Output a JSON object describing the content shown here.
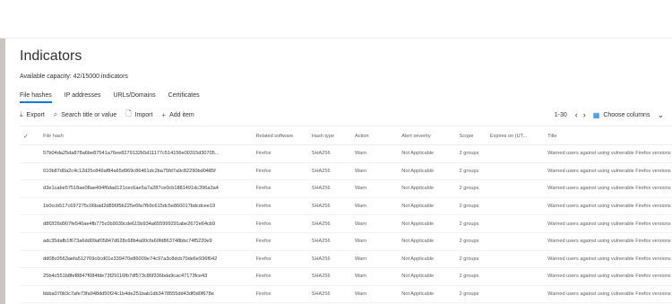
{
  "page": {
    "title": "Indicators",
    "capacity": "Available capacity: 42/15000 indicators"
  },
  "tabs": [
    {
      "label": "File hashes",
      "selected": true
    },
    {
      "label": "IP addresses",
      "selected": false
    },
    {
      "label": "URLs/Domains",
      "selected": false
    },
    {
      "label": "Certificates",
      "selected": false
    }
  ],
  "toolbar": {
    "export_label": "Export",
    "search_label": "Search title or value",
    "import_label": "Import",
    "add_label": "Add item",
    "pager": "1-30",
    "columns_label": "Choose columns"
  },
  "table": {
    "headers": [
      "File hash",
      "Related software",
      "Hash type",
      "Action",
      "Alert severity",
      "Scope",
      "Expires on (UT...",
      "Title"
    ],
    "rows": [
      [
        "57b04da25da878a6be87541a76ee8279132b5d11177c514156e00315d30705...",
        "Firefox",
        "SHA256",
        "Warn",
        "Not Applicable",
        "2 groups",
        "",
        "Warned users against using vulnerable Firefox versions"
      ],
      [
        "010b87d0a2c4c12d25c849af84a65d969c86461dc2ba75fd7a9c82290bd0485f",
        "Firefox",
        "SHA256",
        "Warn",
        "Not Applicable",
        "2 groups",
        "",
        "Warned users against using vulnerable Firefox versions"
      ],
      [
        "d3e1cabe57518ae08ae494f6dad121cec6ae5a7a287ce0cb1881491dc396a3a4",
        "Firefox",
        "SHA256",
        "Warn",
        "Not Applicable",
        "2 groups",
        "",
        "Warned users against using vulnerable Firefox versions"
      ],
      [
        "1b0ccb517c697275c06bad2d896f5b225e6fa7fb9c615dc5e860017bdcdcee19",
        "Firefox",
        "SHA256",
        "Warn",
        "Not Applicable",
        "2 groups",
        "",
        "Warned users against using vulnerable Firefox versions"
      ],
      [
        "d8f2f26d907fe540ae4fb775c0b9039cde615b934a655999291abe2672e64cb9",
        "Firefox",
        "SHA256",
        "Warn",
        "Not Applicable",
        "2 groups",
        "",
        "Warned users against using vulnerable Firefox versions"
      ],
      [
        "adc35dafb1f673a6dd09af05847d628c68b4a00cfa60fd863748bbc74f5220e9",
        "Firefox",
        "SHA256",
        "Warn",
        "Not Applicable",
        "2 groups",
        "",
        "Warned users against using vulnerable Firefox versions"
      ],
      [
        "dd08c0563aefa512769c0cd01e339470e86009e74c97a3c8dcb70de6e936f642",
        "Firefox",
        "SHA256",
        "Warn",
        "Not Applicable",
        "2 groups",
        "",
        "Warned users against using vulnerable Firefox versions"
      ],
      [
        "25b4c551b8fef8847f084fde73f29116fb7df573c86f336bda9cac47173fce43",
        "Firefox",
        "SHA256",
        "Warn",
        "Not Applicable",
        "2 groups",
        "",
        "Warned users against using vulnerable Firefox versions"
      ],
      [
        "bbba070b3c7afe73fa948dd50f24c1b4de251bab1db3478555dd43df0d0f678e",
        "Firefox",
        "SHA256",
        "Warn",
        "Not Applicable",
        "2 groups",
        "",
        "Warned users against using vulnerable Firefox versions"
      ]
    ]
  }
}
